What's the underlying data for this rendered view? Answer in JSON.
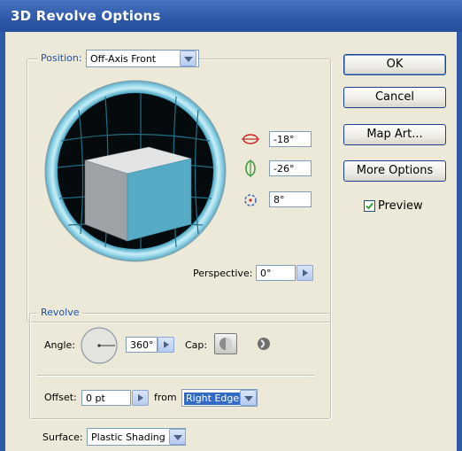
{
  "window": {
    "title": "3D Revolve Options"
  },
  "position": {
    "legend": "Position:",
    "preset": "Off-Axis Front",
    "x_rotation": "-18°",
    "y_rotation": "-26°",
    "z_rotation": "8°",
    "perspective_label": "Perspective:",
    "perspective_value": "0°"
  },
  "revolve": {
    "legend": "Revolve",
    "angle_label": "Angle:",
    "angle_value": "360°",
    "cap_label": "Cap:",
    "offset_label": "Offset:",
    "offset_value": "0 pt",
    "from_label": "from",
    "from_value": "Right Edge"
  },
  "surface": {
    "label": "Surface:",
    "value": "Plastic Shading"
  },
  "buttons": {
    "ok": "OK",
    "cancel": "Cancel",
    "map_art": "Map Art...",
    "more_options": "More Options"
  },
  "preview": {
    "label": "Preview",
    "checked": true
  },
  "colors": {
    "title_bar": "#2f5aa8",
    "cube_front": "#56abc4",
    "accent_red": "#cc2a2a",
    "accent_green": "#3c9a3c"
  }
}
